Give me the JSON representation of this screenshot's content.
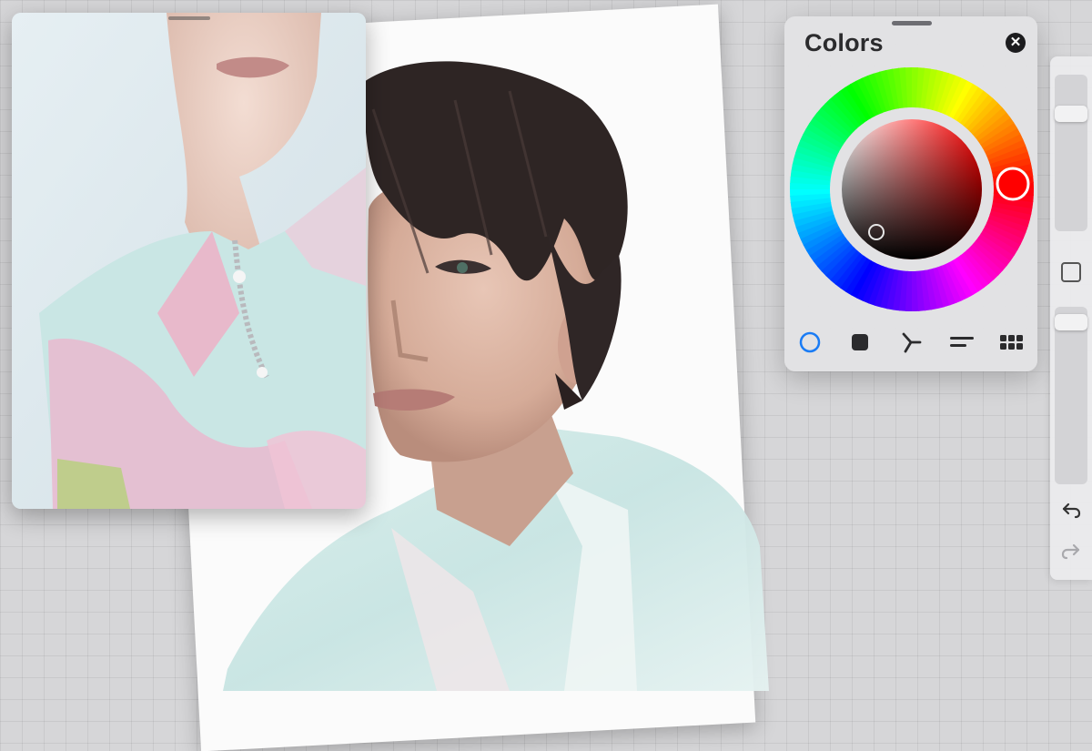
{
  "colors_panel": {
    "title": "Colors",
    "close_icon": "close-icon",
    "current_color": "#ff0000",
    "mode_tabs": [
      {
        "name": "disc",
        "icon": "disc-mode-icon",
        "active": true
      },
      {
        "name": "classic",
        "icon": "classic-mode-icon",
        "active": false
      },
      {
        "name": "harmony",
        "icon": "harmony-mode-icon",
        "active": false
      },
      {
        "name": "value",
        "icon": "value-mode-icon",
        "active": false
      },
      {
        "name": "palettes",
        "icon": "palettes-mode-icon",
        "active": false
      }
    ]
  },
  "side_toolbar": {
    "brush_size_icon": "brush-size-slider",
    "modify_icon": "modify-square-icon",
    "opacity_icon": "opacity-slider",
    "undo_icon": "undo-arrow-icon",
    "redo_icon": "redo-arrow-icon"
  },
  "reference_window": {
    "handle_icon": "drag-handle"
  },
  "colors": {
    "accent": "#1a7cf5",
    "canvas_bg": "#d6d6d8"
  }
}
